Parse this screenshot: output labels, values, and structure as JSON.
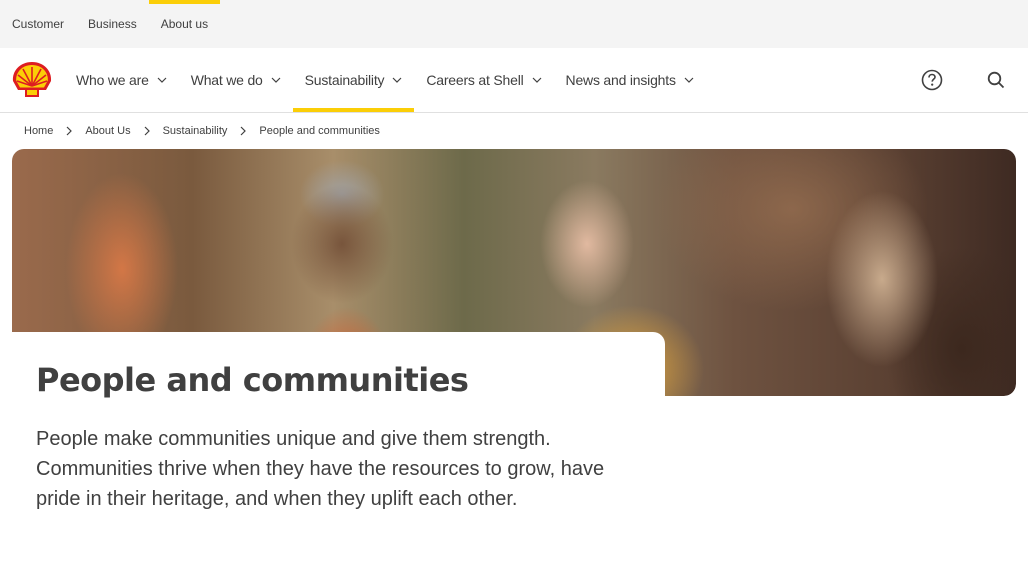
{
  "topbar": {
    "links": [
      "Customer",
      "Business",
      "About us"
    ],
    "active_index": 2
  },
  "brand": {
    "logo": "shell-pecten-logo",
    "accent": "#fbce07",
    "red": "#dd1d21"
  },
  "nav": {
    "items": [
      "Who we are",
      "What we do",
      "Sustainability",
      "Careers at Shell",
      "News and insights"
    ],
    "active_index": 2,
    "right_icons": [
      "help-icon",
      "search-icon"
    ]
  },
  "breadcrumb": [
    "Home",
    "About Us",
    "Sustainability",
    "People and communities"
  ],
  "hero": {
    "image": "group-of-people-talking-outdoors"
  },
  "page": {
    "title": "People and communities",
    "intro": "People make communities unique and give them strength. Communities thrive when they have the resources to grow, have pride in their heritage, and when they uplift each other."
  }
}
